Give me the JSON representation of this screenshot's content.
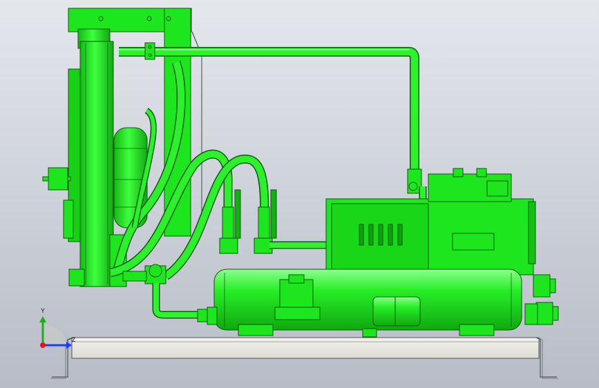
{
  "viewport": {
    "background_top": "#e4e7ec",
    "background_bottom": "#b7bcc6"
  },
  "model": {
    "body_color": "#1ee61e",
    "edge_color": "#0a5a0a",
    "highlight_color": "#7dff7d",
    "base_fill": "#e9e8e2",
    "base_edge": "#5a5a5a"
  },
  "triad": {
    "y_label": "Y",
    "z_label": "Z",
    "x_color": "#1a3cff",
    "y_color": "#1faa1f",
    "z_color": "#e01a1a"
  }
}
